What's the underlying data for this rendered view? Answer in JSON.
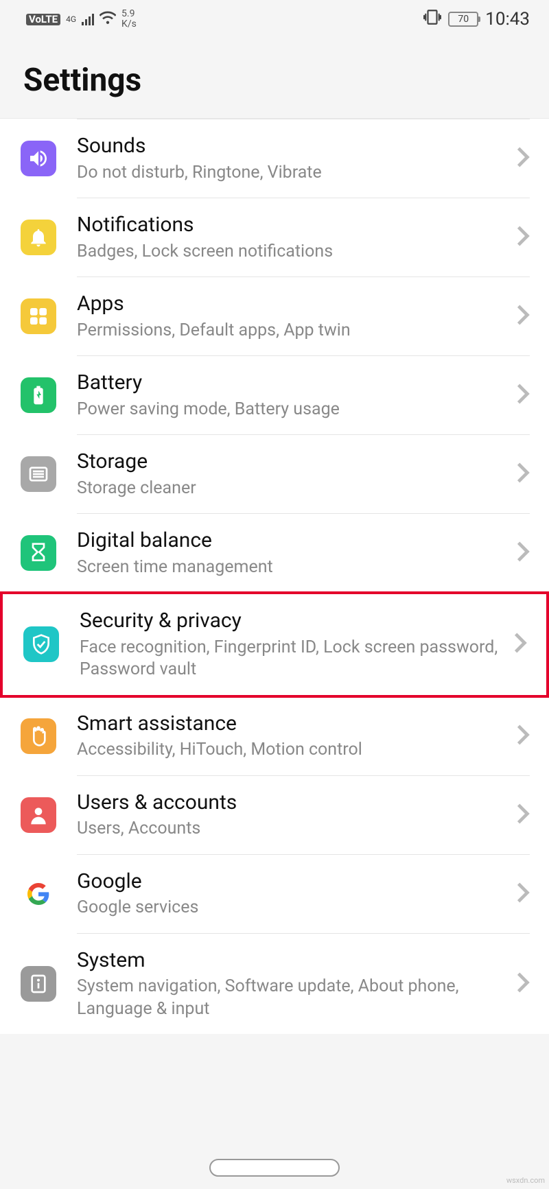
{
  "status": {
    "volte": "VoLTE",
    "net": "4G",
    "speed_value": "5.9",
    "speed_unit": "K/s",
    "battery": "70",
    "time": "10:43"
  },
  "header": {
    "title": "Settings"
  },
  "items": [
    {
      "key": "sounds",
      "title": "Sounds",
      "sub": "Do not disturb, Ringtone, Vibrate"
    },
    {
      "key": "notifications",
      "title": "Notifications",
      "sub": "Badges, Lock screen notifications"
    },
    {
      "key": "apps",
      "title": "Apps",
      "sub": "Permissions, Default apps, App twin"
    },
    {
      "key": "battery",
      "title": "Battery",
      "sub": "Power saving mode, Battery usage"
    },
    {
      "key": "storage",
      "title": "Storage",
      "sub": "Storage cleaner"
    },
    {
      "key": "digital_balance",
      "title": "Digital balance",
      "sub": "Screen time management"
    },
    {
      "key": "security",
      "title": "Security & privacy",
      "sub": "Face recognition, Fingerprint ID, Lock screen password, Password vault"
    },
    {
      "key": "smart",
      "title": "Smart assistance",
      "sub": "Accessibility, HiTouch, Motion control"
    },
    {
      "key": "users",
      "title": "Users & accounts",
      "sub": "Users, Accounts"
    },
    {
      "key": "google",
      "title": "Google",
      "sub": "Google services"
    },
    {
      "key": "system",
      "title": "System",
      "sub": "System navigation, Software update, About phone, Language & input"
    }
  ],
  "watermark": "wsxdn.com"
}
